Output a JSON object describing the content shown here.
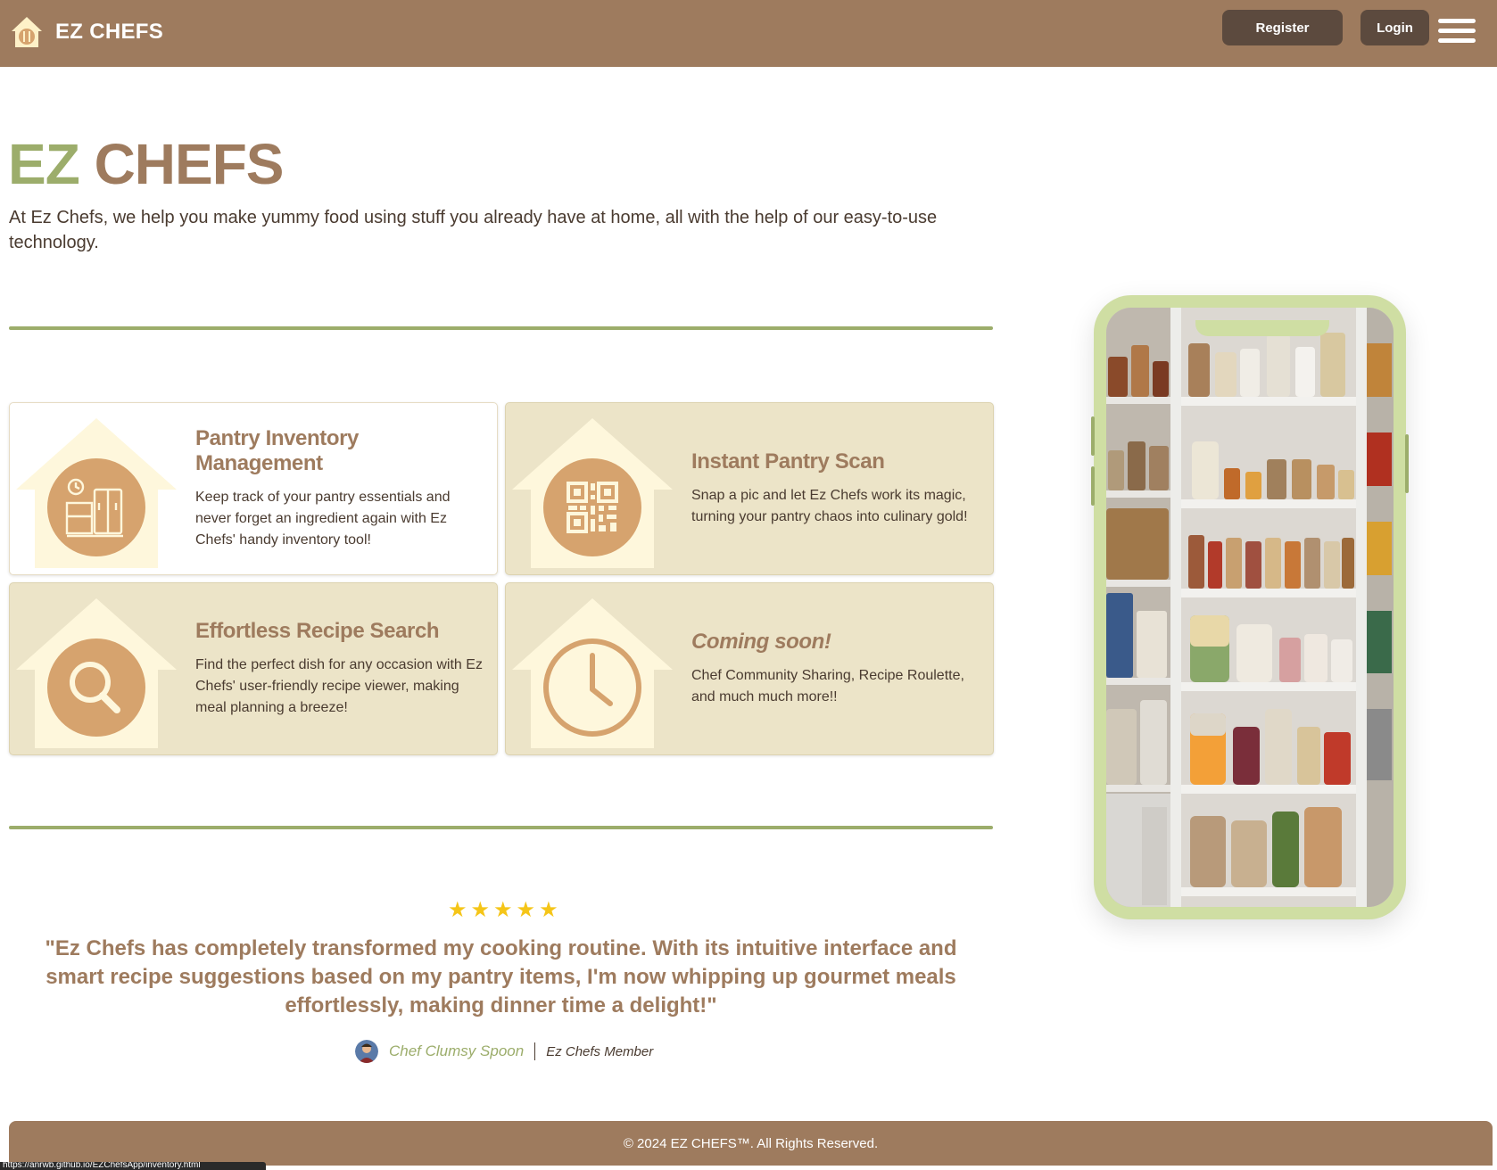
{
  "navbar": {
    "brand_name": "EZ CHEFS",
    "register_label": "Register",
    "login_label": "Login"
  },
  "hero": {
    "title_part1": "EZ",
    "title_part2": "CHEFS",
    "description": "At Ez Chefs, we help you make yummy food using stuff you already have at home, all with the help of our easy-to-use technology."
  },
  "features": [
    {
      "title": "Pantry Inventory Management",
      "description": "Keep track of your pantry essentials and never forget an ingredient again with Ez Chefs' handy inventory tool!",
      "icon": "pantry-kitchen-icon"
    },
    {
      "title": "Instant Pantry Scan",
      "description": "Snap a pic and let Ez Chefs work its magic, turning your pantry chaos into culinary gold!",
      "icon": "qr-code-icon"
    },
    {
      "title": "Effortless Recipe Search",
      "description": "Find the perfect dish for any occasion with Ez Chefs' user-friendly recipe viewer, making meal planning a breeze!",
      "icon": "search-icon"
    },
    {
      "title": "Coming soon!",
      "description": "Chef Community Sharing, Recipe Roulette, and much much more!!",
      "icon": "clock-icon"
    }
  ],
  "testimonial": {
    "rating": 5,
    "quote": "\"Ez Chefs has completely transformed my cooking routine. With its intuitive interface and smart recipe suggestions based on my pantry items, I'm now whipping up gourmet meals effortlessly, making dinner time a delight!\"",
    "author_name": "Chef Clumsy Spoon",
    "author_role": "Ez Chefs Member"
  },
  "footer": {
    "copyright": "© 2024 EZ CHEFS™. All Rights Reserved."
  },
  "status_bar": {
    "url": "https://anrwb.github.io/EZChefsApp/inventory.html"
  },
  "colors": {
    "brand_brown": "#9e7b5e",
    "dark_brown": "#5c4a3e",
    "accent_green": "#9cad6b",
    "card_beige": "#ece4c8",
    "phone_green": "#cfdea3",
    "icon_tan": "#d6a36e",
    "house_cream": "#fef7dc",
    "star_gold": "#f5c518"
  }
}
